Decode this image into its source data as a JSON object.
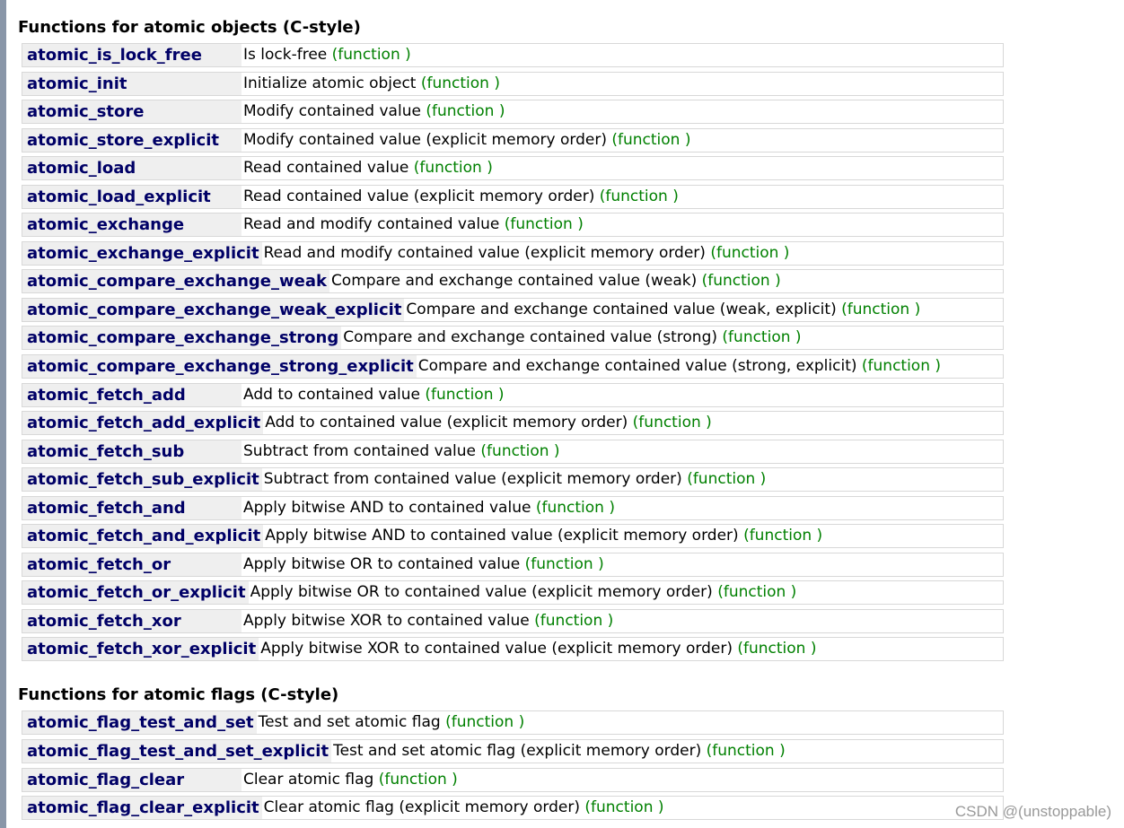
{
  "sections": [
    {
      "title": "Functions for atomic objects (C-style)",
      "items": [
        {
          "name": "atomic_is_lock_free",
          "desc": "Is lock-free",
          "tag": "(function )"
        },
        {
          "name": "atomic_init",
          "desc": "Initialize atomic object",
          "tag": "(function )"
        },
        {
          "name": "atomic_store",
          "desc": "Modify contained value",
          "tag": "(function )"
        },
        {
          "name": "atomic_store_explicit",
          "desc": "Modify contained value (explicit memory order)",
          "tag": "(function )"
        },
        {
          "name": "atomic_load",
          "desc": "Read contained value",
          "tag": "(function )"
        },
        {
          "name": "atomic_load_explicit",
          "desc": "Read contained value (explicit memory order)",
          "tag": "(function )"
        },
        {
          "name": "atomic_exchange",
          "desc": "Read and modify contained value",
          "tag": "(function )"
        },
        {
          "name": "atomic_exchange_explicit",
          "desc": "Read and modify contained value (explicit memory order)",
          "tag": "(function )"
        },
        {
          "name": "atomic_compare_exchange_weak",
          "desc": "Compare and exchange contained value (weak)",
          "tag": "(function )"
        },
        {
          "name": "atomic_compare_exchange_weak_explicit",
          "desc": "Compare and exchange contained value (weak, explicit)",
          "tag": "(function )"
        },
        {
          "name": "atomic_compare_exchange_strong",
          "desc": "Compare and exchange contained value (strong)",
          "tag": "(function )"
        },
        {
          "name": "atomic_compare_exchange_strong_explicit",
          "desc": "Compare and exchange contained value (strong, explicit)",
          "tag": "(function )"
        },
        {
          "name": "atomic_fetch_add",
          "desc": "Add to contained value",
          "tag": "(function )"
        },
        {
          "name": "atomic_fetch_add_explicit",
          "desc": "Add to contained value (explicit memory order)",
          "tag": "(function )"
        },
        {
          "name": "atomic_fetch_sub",
          "desc": "Subtract from contained value",
          "tag": "(function )"
        },
        {
          "name": "atomic_fetch_sub_explicit",
          "desc": "Subtract from contained value (explicit memory order)",
          "tag": "(function )"
        },
        {
          "name": "atomic_fetch_and",
          "desc": "Apply bitwise AND to contained value",
          "tag": "(function )"
        },
        {
          "name": "atomic_fetch_and_explicit",
          "desc": "Apply bitwise AND to contained value (explicit memory order)",
          "tag": "(function )"
        },
        {
          "name": "atomic_fetch_or",
          "desc": "Apply bitwise OR to contained value",
          "tag": "(function )"
        },
        {
          "name": "atomic_fetch_or_explicit",
          "desc": "Apply bitwise OR to contained value (explicit memory order)",
          "tag": "(function )"
        },
        {
          "name": "atomic_fetch_xor",
          "desc": "Apply bitwise XOR to contained value",
          "tag": "(function )"
        },
        {
          "name": "atomic_fetch_xor_explicit",
          "desc": "Apply bitwise XOR to contained value (explicit memory order)",
          "tag": "(function )"
        }
      ]
    },
    {
      "title": "Functions for atomic flags (C-style)",
      "items": [
        {
          "name": "atomic_flag_test_and_set",
          "desc": "Test and set atomic flag",
          "tag": "(function )"
        },
        {
          "name": "atomic_flag_test_and_set_explicit",
          "desc": "Test and set atomic flag (explicit memory order)",
          "tag": "(function )"
        },
        {
          "name": "atomic_flag_clear",
          "desc": "Clear atomic flag",
          "tag": "(function )"
        },
        {
          "name": "atomic_flag_clear_explicit",
          "desc": "Clear atomic flag (explicit memory order)",
          "tag": "(function )"
        }
      ]
    }
  ],
  "watermark": "CSDN @(unstoppable)",
  "colors": {
    "name_text": "#000066",
    "name_bg": "#efefef",
    "tag_text": "#008000",
    "border": "#d8d8d8",
    "left_rule": "#8996a8"
  }
}
